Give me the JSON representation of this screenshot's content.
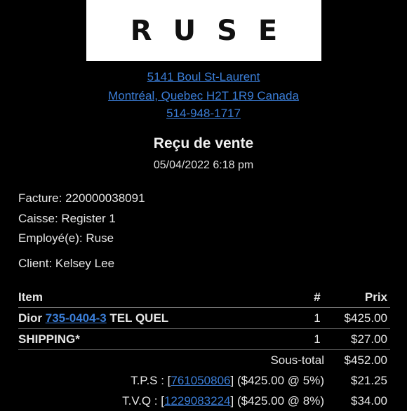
{
  "store": {
    "logo_text": "RUSE",
    "address_line1": "5141 Boul St-Laurent",
    "address_line2": "Montréal, Quebec H2T 1R9 Canada",
    "phone": "514-948-1717"
  },
  "receipt": {
    "title": "Reçu de vente",
    "datetime": "05/04/2022 6:18 pm",
    "facture": "Facture: 220000038091",
    "caisse": "Caisse: Register 1",
    "employe": "Employé(e): Ruse",
    "client": "Client: Kelsey Lee"
  },
  "table": {
    "headers": {
      "item": "Item",
      "qty": "#",
      "price": "Prix"
    },
    "items": [
      {
        "prefix": "Dior ",
        "sku": "735-0404-3",
        "suffix": " TEL QUEL",
        "qty": "1",
        "price": "$425.00"
      },
      {
        "name": "SHIPPING*",
        "qty": "1",
        "price": "$27.00"
      }
    ],
    "subtotal_label": "Sous-total",
    "subtotal_value": "$452.00",
    "tps": {
      "label_prefix": "T.P.S : [",
      "number": "761050806",
      "label_suffix": "] ($425.00 @ 5%)",
      "value": "$21.25"
    },
    "tvq": {
      "label_prefix": "T.V.Q : [",
      "number": "1229083224",
      "label_suffix": "] ($425.00 @ 8%)",
      "value": "$34.00"
    }
  },
  "colors": {
    "background": "#000000",
    "link": "#3b7ed8",
    "text": "#e6e6e6"
  }
}
